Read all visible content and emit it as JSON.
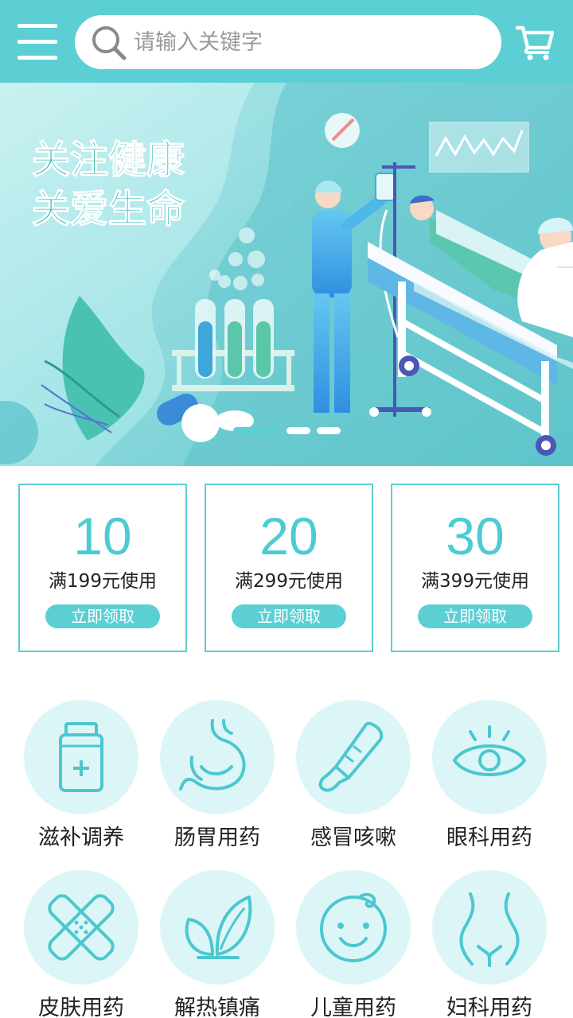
{
  "header": {
    "menu_icon": "menu-icon",
    "search_icon": "search-icon",
    "cart_icon": "cart-icon",
    "search_placeholder": "请输入关键字",
    "search_value": "",
    "accent_color": "#5ccfd4"
  },
  "banner": {
    "line1": "关注健康",
    "line2": "关爱生命",
    "active_slide": 1,
    "slide_count": 3
  },
  "coupons": [
    {
      "amount": "10",
      "condition": "满199元使用",
      "button": "立即领取"
    },
    {
      "amount": "20",
      "condition": "满299元使用",
      "button": "立即领取"
    },
    {
      "amount": "30",
      "condition": "满399元使用",
      "button": "立即领取"
    }
  ],
  "categories": [
    {
      "label": "滋补调养",
      "icon": "medicine-bottle-icon"
    },
    {
      "label": "肠胃用药",
      "icon": "stomach-icon"
    },
    {
      "label": "感冒咳嗽",
      "icon": "thermometer-icon"
    },
    {
      "label": "眼科用药",
      "icon": "eye-icon"
    },
    {
      "label": "皮肤用药",
      "icon": "bandage-icon"
    },
    {
      "label": "解热镇痛",
      "icon": "leaf-icon"
    },
    {
      "label": "儿童用药",
      "icon": "baby-face-icon"
    },
    {
      "label": "妇科用药",
      "icon": "female-body-icon"
    }
  ]
}
